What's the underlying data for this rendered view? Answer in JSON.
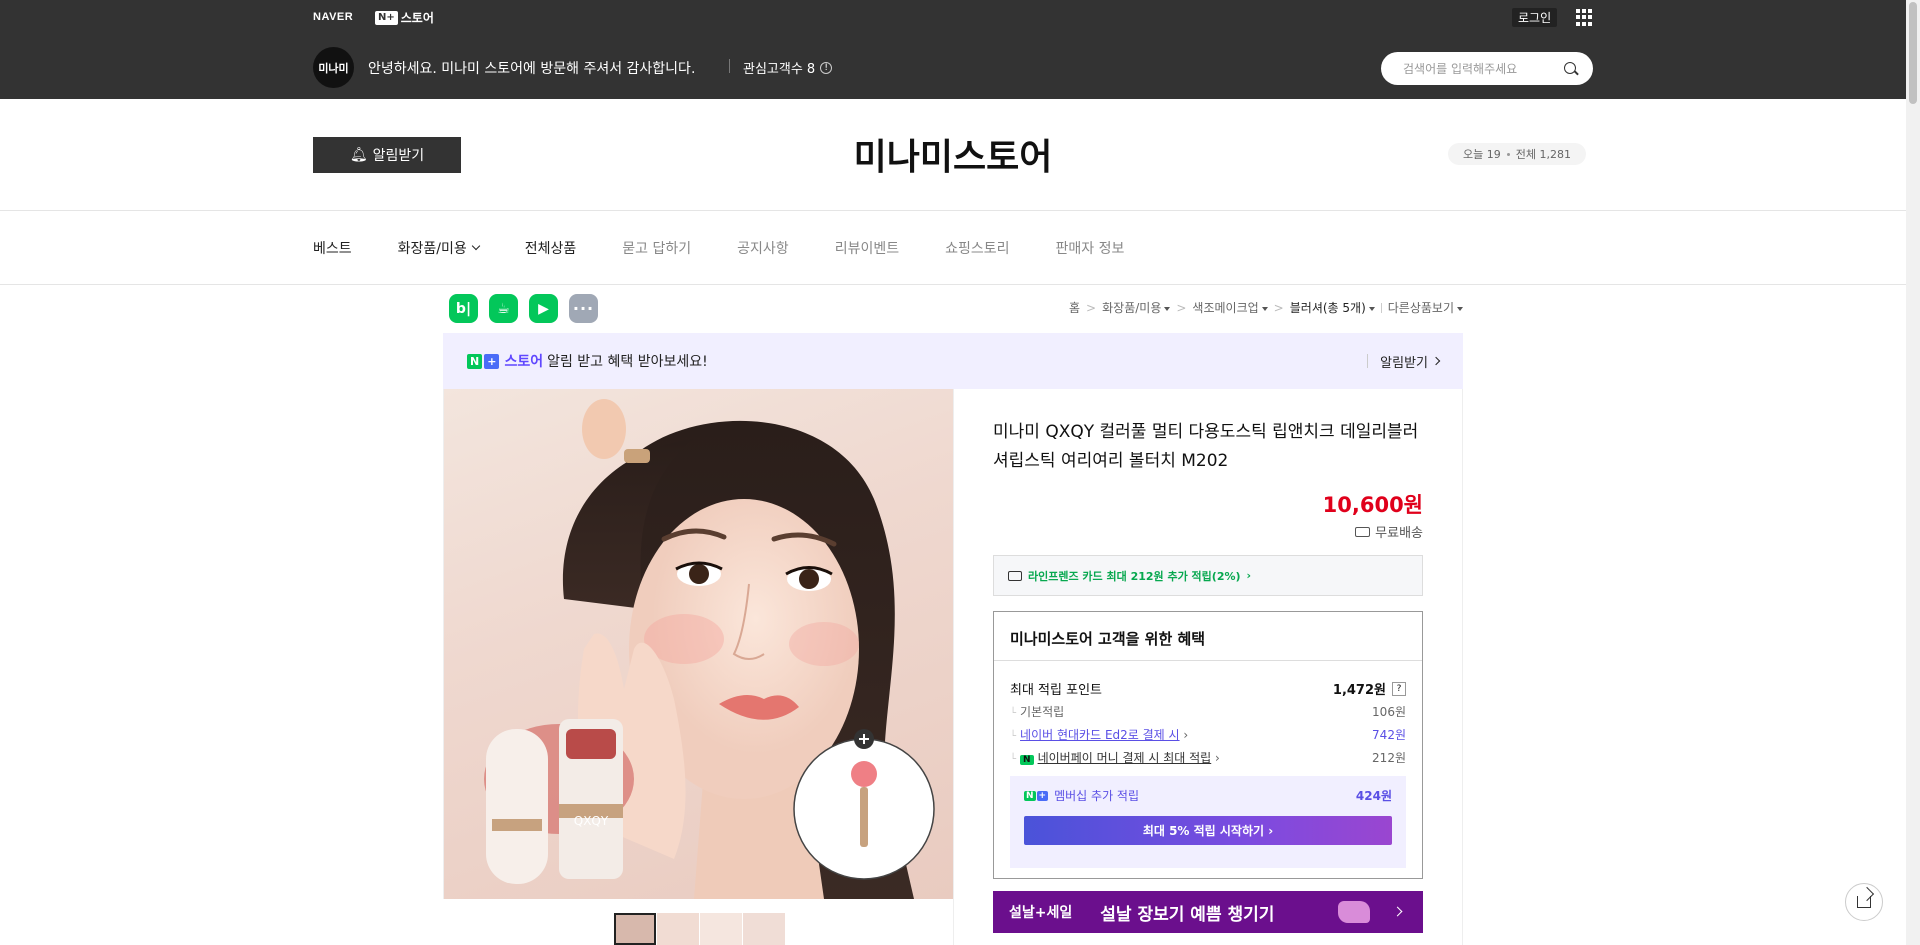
{
  "topbar": {
    "naver_logo": "NAVER",
    "nplus_badge": "N+",
    "store_logo": "스토어",
    "login": "로그인",
    "avatar_text": "미나미",
    "greeting": "안녕하세요. 미나미 스토어에 방문해 주셔서 감사합니다.",
    "interest_label": "관심고객수 8",
    "search_placeholder": "검색어를 입력해주세요"
  },
  "header": {
    "alarm_button": "알림받기",
    "store_title": "미나미스토어",
    "today_label": "오늘 19",
    "total_label": "전체 1,281"
  },
  "nav": {
    "items": [
      {
        "label": "베스트"
      },
      {
        "label": "화장품/미용"
      },
      {
        "label": "전체상품"
      },
      {
        "label": "묻고 답하기"
      },
      {
        "label": "공지사항"
      },
      {
        "label": "리뷰이벤트"
      },
      {
        "label": "쇼핑스토리"
      },
      {
        "label": "판매자 정보"
      }
    ]
  },
  "share_icons": {
    "blog": "b|",
    "cafe": "☕",
    "keep": "▶",
    "more": "···"
  },
  "breadcrumb": {
    "home": "홈",
    "cat1": "화장품/미용",
    "cat2": "색조메이크업",
    "cat3": "블러셔(총 5개)",
    "other": "다른상품보기"
  },
  "promo": {
    "n_badge": "N",
    "plus_badge": "+",
    "store": "스토어",
    "text": "알림 받고 혜택 받아보세요!",
    "button": "알림받기"
  },
  "product": {
    "title": "미나미 QXQY 컬러풀 멀티 다용도스틱 립앤치크 데일리블러셔립스틱 여리여리 볼터치 M202",
    "price": "10,600원",
    "shipping": "무료배송",
    "card_benefit": "라인프렌즈 카드 최대 212원 추가 적립(2%)",
    "product_brand_text": "QXQY"
  },
  "benefit": {
    "title": "미나미스토어 고객을 위한 혜택",
    "max_points_label": "최대 적립 포인트",
    "max_points_value": "1,472원",
    "help": "?",
    "rows": [
      {
        "label": "기본적립",
        "value": "106원"
      },
      {
        "label": "네이버 현대카드 Ed2로 결제 시",
        "value": "742원"
      },
      {
        "label": "네이버페이 머니 결제 시 최대 적립",
        "value": "212원"
      }
    ],
    "npay_badge": "N",
    "membership_label": "멤버십 추가 적립",
    "membership_value": "424원",
    "membership_button": "최대 5% 적립 시작하기"
  },
  "sale_banner": {
    "left": "설날+세일",
    "main": "설날 장보기 예쁨 챙기기"
  },
  "colors": {
    "topbar_bg": "#333333",
    "price_red": "#e0001b",
    "naver_green": "#03c75a",
    "purple": "#5a4fe5",
    "sale_bg": "#6b0f8d"
  }
}
